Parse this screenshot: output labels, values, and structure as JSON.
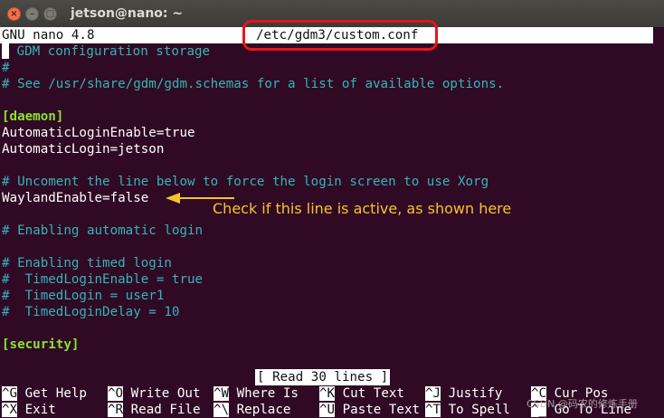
{
  "window": {
    "title": "jetson@nano: ~",
    "close_glyph": "×",
    "min_glyph": "–",
    "max_glyph": "□"
  },
  "nano": {
    "version": "GNU nano 4.8",
    "filename": "/etc/gdm3/custom.conf",
    "status": "[ Read 30 lines ]"
  },
  "file_lines": [
    "# GDM configuration storage",
    "#",
    "# See /usr/share/gdm/gdm.schemas for a list of available options.",
    "",
    "[daemon]",
    "AutomaticLoginEnable=true",
    "AutomaticLogin=jetson",
    "",
    "# Uncoment the line below to force the login screen to use Xorg",
    "WaylandEnable=false",
    "",
    "# Enabling automatic login",
    "",
    "# Enabling timed login",
    "#  TimedLoginEnable = true",
    "#  TimedLogin = user1",
    "#  TimedLoginDelay = 10",
    "",
    "[security]"
  ],
  "shortcuts_row1": [
    {
      "key": "^G",
      "label": "Get Help"
    },
    {
      "key": "^O",
      "label": "Write Out"
    },
    {
      "key": "^W",
      "label": "Where Is"
    },
    {
      "key": "^K",
      "label": "Cut Text"
    },
    {
      "key": "^J",
      "label": "Justify"
    },
    {
      "key": "^C",
      "label": "Cur Pos"
    }
  ],
  "shortcuts_row2": [
    {
      "key": "^X",
      "label": "Exit"
    },
    {
      "key": "^R",
      "label": "Read File"
    },
    {
      "key": "^\\",
      "label": "Replace"
    },
    {
      "key": "^U",
      "label": "Paste Text"
    },
    {
      "key": "^T",
      "label": "To Spell"
    },
    {
      "key": "^_",
      "label": "Go To Line"
    }
  ],
  "annotation": {
    "note": "Check if this line is active, as shown here",
    "highlight_color": "#e8141b",
    "note_color": "#f6c32d"
  },
  "watermark": "CSDN @码农的修炼手册",
  "colors": {
    "background": "#300a24",
    "comment": "#34b5b5",
    "section": "#8ae234",
    "text": "#ffffff"
  }
}
